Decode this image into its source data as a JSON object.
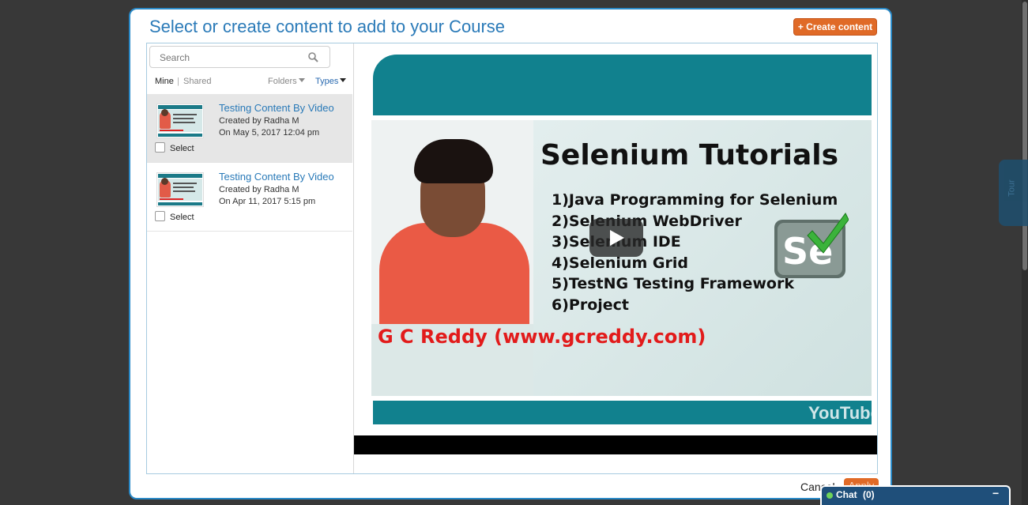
{
  "modal": {
    "title": "Select or create content to add to your Course",
    "create_label": "+ Create content"
  },
  "search": {
    "placeholder": "Search"
  },
  "filters": {
    "mine": "Mine",
    "separator": "|",
    "shared": "Shared",
    "folders": "Folders",
    "types": "Types"
  },
  "items": [
    {
      "title": "Testing Content By Video",
      "created_by": "Created by Radha M",
      "date": "On May 5, 2017 12:04 pm",
      "select_label": "Select",
      "selected": true
    },
    {
      "title": "Testing Content By Video",
      "created_by": "Created by Radha M",
      "date": "On Apr 11, 2017 5:15 pm",
      "select_label": "Select",
      "selected": false
    }
  ],
  "video": {
    "heading": "Selenium Tutorials",
    "list": [
      "1)Java Programming for Selenium",
      "2)Selenium WebDriver",
      "3)Selenium IDE",
      "4)Selenium Grid",
      "5)TestNG Testing Framework",
      "6)Project"
    ],
    "logo_text": "Se",
    "credit": "G C Reddy (www.gcreddy.com)",
    "brand": "YouTube"
  },
  "footer": {
    "cancel_label": "Cancel",
    "apply_label": "Apply"
  },
  "side_tab": {
    "label": "Tour"
  },
  "chat": {
    "label": "Chat",
    "count": "(0)",
    "minimize": "−"
  },
  "colors": {
    "accent": "#2a7ab8",
    "button": "#e06a27",
    "teal": "#11818e"
  }
}
